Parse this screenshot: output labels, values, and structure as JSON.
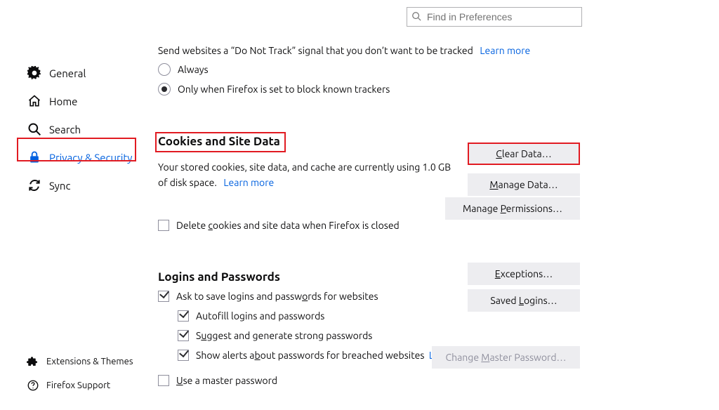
{
  "search": {
    "placeholder": "Find in Preferences"
  },
  "sidebar": {
    "items": [
      {
        "label": "General"
      },
      {
        "label": "Home"
      },
      {
        "label": "Search"
      },
      {
        "label": "Privacy & Security"
      },
      {
        "label": "Sync"
      }
    ]
  },
  "bottom_sidebar": {
    "extensions": "Extensions & Themes",
    "support": "Firefox Support"
  },
  "dnt": {
    "desc": "Send websites a “Do Not Track” signal that you don’t want to be tracked",
    "learn_more": "Learn more",
    "option_always": "Always",
    "option_only_firefox": "Only when Firefox is set to block known trackers",
    "selected": "only"
  },
  "cookies": {
    "heading": "Cookies and Site Data",
    "desc_prefix": "Your stored cookies, site data, and cache are currently using 1.0 GB of disk space.",
    "learn_more": "Learn more",
    "delete_on_close_pre": "Delete ",
    "delete_on_close_post": "ookies and site data when Firefox is closed",
    "delete_on_close_checked": false,
    "btn_clear_pre": "C",
    "btn_clear_post": "ear Data…",
    "btn_manage_data_pre": "M",
    "btn_manage_data_post": "anage Data…",
    "btn_manage_perm_pre": "Manage ",
    "btn_manage_perm_post": "ermissions…"
  },
  "logins": {
    "heading": "Logins and Passwords",
    "ask_save_pre": "Ask to save logins and passw",
    "ask_save_post": "rds for websites",
    "ask_save_checked": true,
    "autofill": "Autofill logins and passwords",
    "autofill_checked": true,
    "suggest_pre": "S",
    "suggest_post": "ggest and generate strong passwords",
    "suggest_checked": true,
    "breach_pre": "Show alerts a",
    "breach_post": "out passwords for breached websites",
    "breach_checked": true,
    "breach_learn_more": "Learn more",
    "master_pre": "U",
    "master_post": "se a master password",
    "master_checked": false,
    "btn_exceptions_pre": "E",
    "btn_exceptions_post": "ceptions…",
    "btn_saved_pre": "Saved ",
    "btn_saved_post": "ogins…",
    "btn_change_master_pre": "Change ",
    "btn_change_master_post": "aster Password…"
  }
}
